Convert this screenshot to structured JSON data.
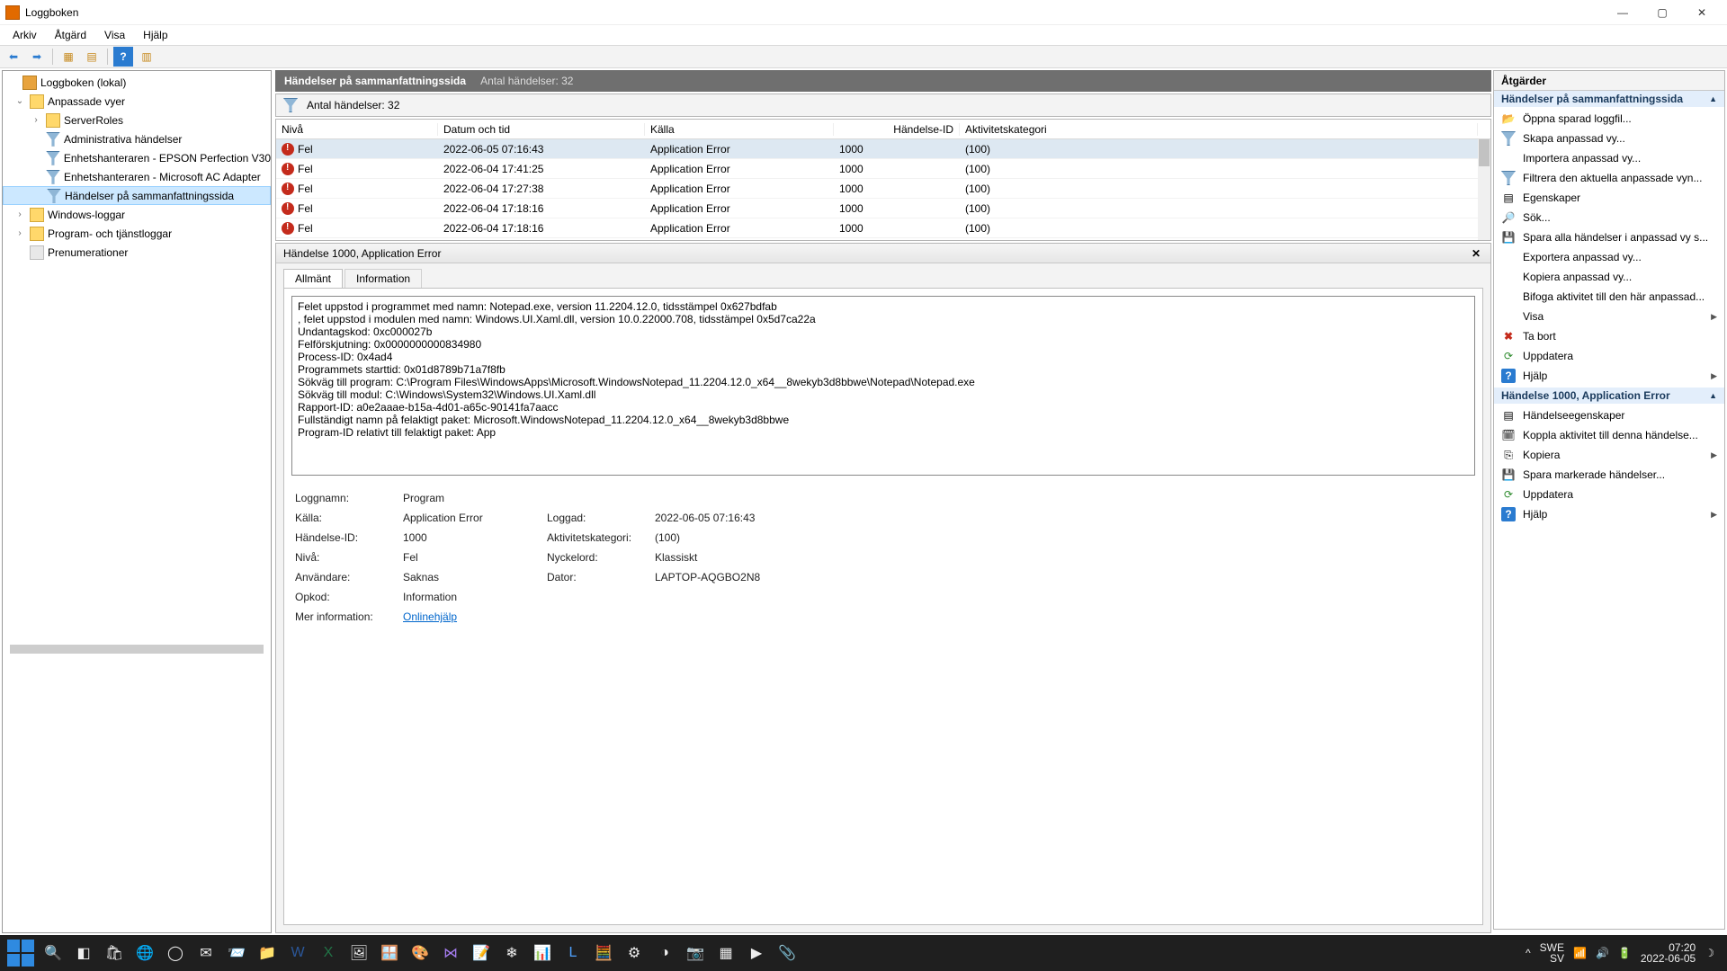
{
  "window": {
    "title": "Loggboken"
  },
  "menu": {
    "file": "Arkiv",
    "action": "Åtgärd",
    "view": "Visa",
    "help": "Hjälp"
  },
  "tree": {
    "root": "Loggboken (lokal)",
    "custom_views": "Anpassade vyer",
    "server_roles": "ServerRoles",
    "admin_events": "Administrativa händelser",
    "devmgr_epson": "Enhetshanteraren - EPSON Perfection V30",
    "devmgr_ac": "Enhetshanteraren - Microsoft AC Adapter",
    "summary_events": "Händelser på sammanfattningssida",
    "windows_logs": "Windows-loggar",
    "app_service_logs": "Program- och tjänstloggar",
    "subscriptions": "Prenumerationer"
  },
  "caption": {
    "title": "Händelser på sammanfattningssida",
    "count_label": "Antal händelser: 32"
  },
  "filterbar": {
    "label": "Antal händelser: 32"
  },
  "grid": {
    "headers": {
      "level": "Nivå",
      "date": "Datum och tid",
      "source": "Källa",
      "event_id": "Händelse-ID",
      "task": "Aktivitetskategori"
    },
    "rows": [
      {
        "level": "Fel",
        "date": "2022-06-05 07:16:43",
        "source": "Application Error",
        "eid": "1000",
        "task": "(100)"
      },
      {
        "level": "Fel",
        "date": "2022-06-04 17:41:25",
        "source": "Application Error",
        "eid": "1000",
        "task": "(100)"
      },
      {
        "level": "Fel",
        "date": "2022-06-04 17:27:38",
        "source": "Application Error",
        "eid": "1000",
        "task": "(100)"
      },
      {
        "level": "Fel",
        "date": "2022-06-04 17:18:16",
        "source": "Application Error",
        "eid": "1000",
        "task": "(100)"
      },
      {
        "level": "Fel",
        "date": "2022-06-04 17:18:16",
        "source": "Application Error",
        "eid": "1000",
        "task": "(100)"
      }
    ]
  },
  "detail": {
    "header": "Händelse 1000, Application Error",
    "tab_general": "Allmänt",
    "tab_info": "Information",
    "message": "Felet uppstod i programmet med namn: Notepad.exe, version 11.2204.12.0, tidsstämpel 0x627bdfab\n, felet uppstod i modulen med namn: Windows.UI.Xaml.dll, version 10.0.22000.708, tidsstämpel 0x5d7ca22a\nUndantagskod: 0xc000027b\nFelförskjutning: 0x0000000000834980\nProcess-ID: 0x4ad4\nProgrammets starttid: 0x01d8789b71a7f8fb\nSökväg till program: C:\\Program Files\\WindowsApps\\Microsoft.WindowsNotepad_11.2204.12.0_x64__8wekyb3d8bbwe\\Notepad\\Notepad.exe\nSökväg till modul: C:\\Windows\\System32\\Windows.UI.Xaml.dll\nRapport-ID: a0e2aaae-b15a-4d01-a65c-90141fa7aacc\nFullständigt namn på felaktigt paket: Microsoft.WindowsNotepad_11.2204.12.0_x64__8wekyb3d8bbwe\nProgram-ID relativt till felaktigt paket: App",
    "props": {
      "logname_k": "Loggnamn:",
      "logname_v": "Program",
      "source_k": "Källa:",
      "source_v": "Application Error",
      "logged_k": "Loggad:",
      "logged_v": "2022-06-05 07:16:43",
      "eid_k": "Händelse-ID:",
      "eid_v": "1000",
      "taskcat_k": "Aktivitetskategori:",
      "taskcat_v": "(100)",
      "level_k": "Nivå:",
      "level_v": "Fel",
      "keywords_k": "Nyckelord:",
      "keywords_v": "Klassiskt",
      "user_k": "Användare:",
      "user_v": "Saknas",
      "computer_k": "Dator:",
      "computer_v": "LAPTOP-AQGBO2N8",
      "opcode_k": "Opkod:",
      "opcode_v": "Information",
      "moreinfo_k": "Mer information:",
      "moreinfo_v": "Onlinehjälp"
    }
  },
  "actions": {
    "title": "Åtgärder",
    "group1": "Händelser på sammanfattningssida",
    "g1": {
      "open_saved": "Öppna sparad loggfil...",
      "create_custom": "Skapa anpassad vy...",
      "import_custom": "Importera anpassad vy...",
      "filter_current": "Filtrera den aktuella anpassade vyn...",
      "properties": "Egenskaper",
      "find": "Sök...",
      "save_all": "Spara alla händelser i anpassad vy s...",
      "export_custom": "Exportera anpassad vy...",
      "copy_custom": "Kopiera anpassad vy...",
      "attach_task": "Bifoga aktivitet till den här anpassad...",
      "view": "Visa",
      "delete": "Ta bort",
      "refresh": "Uppdatera",
      "help": "Hjälp"
    },
    "group2": "Händelse 1000, Application Error",
    "g2": {
      "event_props": "Händelseegenskaper",
      "attach_task2": "Koppla aktivitet till denna händelse...",
      "copy": "Kopiera",
      "save_selected": "Spara markerade händelser...",
      "refresh2": "Uppdatera",
      "help2": "Hjälp"
    }
  },
  "taskbar": {
    "lang1": "SWE",
    "lang2": "SV",
    "time": "07:20",
    "date": "2022-06-05"
  }
}
